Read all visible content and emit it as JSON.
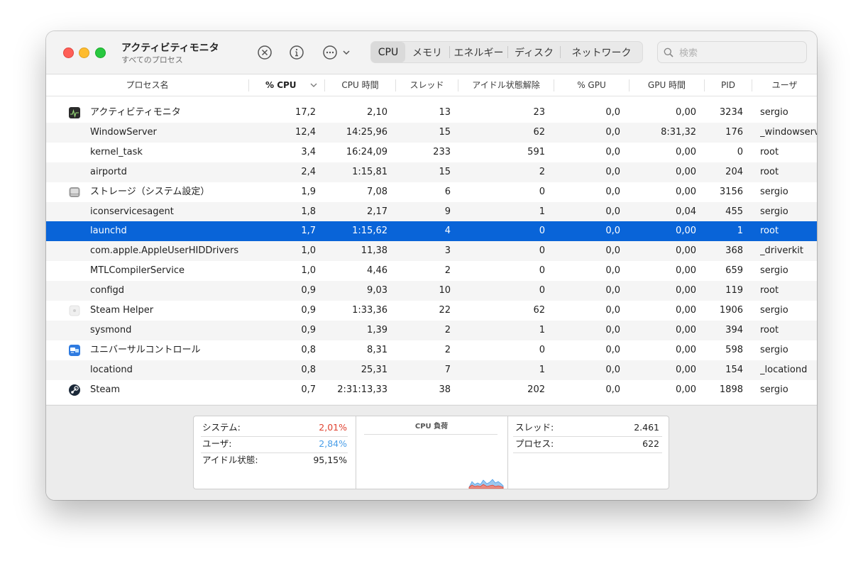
{
  "window": {
    "title": "アクティビティモニタ",
    "subtitle": "すべてのプロセス"
  },
  "toolbar": {
    "stop_icon": "x-circle-icon",
    "info_icon": "info-circle-icon",
    "more_icon": "ellipsis-circle-icon",
    "tabs": [
      "CPU",
      "メモリ",
      "エネルギー",
      "ディスク",
      "ネットワーク"
    ],
    "active_tab": "CPU",
    "search_placeholder": "検索"
  },
  "columns": [
    "プロセス名",
    "% CPU",
    "CPU 時間",
    "スレッド",
    "アイドル状態解除",
    "% GPU",
    "GPU 時間",
    "PID",
    "ユーザ"
  ],
  "processes": [
    {
      "name": "アクティビティモニタ",
      "icon": "activity-monitor-icon",
      "cpu": "17,2",
      "cpu_time": "2,10",
      "threads": "13",
      "wakeups": "23",
      "gpu": "0,0",
      "gpu_time": "0,00",
      "pid": "3234",
      "user": "sergio"
    },
    {
      "name": "WindowServer",
      "icon": "",
      "cpu": "12,4",
      "cpu_time": "14:25,96",
      "threads": "15",
      "wakeups": "62",
      "gpu": "0,0",
      "gpu_time": "8:31,32",
      "pid": "176",
      "user": "_windowserver"
    },
    {
      "name": "kernel_task",
      "icon": "",
      "cpu": "3,4",
      "cpu_time": "16:24,09",
      "threads": "233",
      "wakeups": "591",
      "gpu": "0,0",
      "gpu_time": "0,00",
      "pid": "0",
      "user": "root"
    },
    {
      "name": "airportd",
      "icon": "",
      "cpu": "2,4",
      "cpu_time": "1:15,81",
      "threads": "15",
      "wakeups": "2",
      "gpu": "0,0",
      "gpu_time": "0,00",
      "pid": "204",
      "user": "root"
    },
    {
      "name": "ストレージ（システム設定）",
      "icon": "storage-drive-icon",
      "cpu": "1,9",
      "cpu_time": "7,08",
      "threads": "6",
      "wakeups": "0",
      "gpu": "0,0",
      "gpu_time": "0,00",
      "pid": "3156",
      "user": "sergio"
    },
    {
      "name": "iconservicesagent",
      "icon": "",
      "cpu": "1,8",
      "cpu_time": "2,17",
      "threads": "9",
      "wakeups": "1",
      "gpu": "0,0",
      "gpu_time": "0,04",
      "pid": "455",
      "user": "sergio"
    },
    {
      "name": "launchd",
      "icon": "",
      "cpu": "1,7",
      "cpu_time": "1:15,62",
      "threads": "4",
      "wakeups": "0",
      "gpu": "0,0",
      "gpu_time": "0,00",
      "pid": "1",
      "user": "root",
      "selected": true
    },
    {
      "name": "com.apple.AppleUserHIDDrivers",
      "icon": "",
      "cpu": "1,0",
      "cpu_time": "11,38",
      "threads": "3",
      "wakeups": "0",
      "gpu": "0,0",
      "gpu_time": "0,00",
      "pid": "368",
      "user": "_driverkit"
    },
    {
      "name": "MTLCompilerService",
      "icon": "",
      "cpu": "1,0",
      "cpu_time": "4,46",
      "threads": "2",
      "wakeups": "0",
      "gpu": "0,0",
      "gpu_time": "0,00",
      "pid": "659",
      "user": "sergio"
    },
    {
      "name": "configd",
      "icon": "",
      "cpu": "0,9",
      "cpu_time": "9,03",
      "threads": "10",
      "wakeups": "0",
      "gpu": "0,0",
      "gpu_time": "0,00",
      "pid": "119",
      "user": "root"
    },
    {
      "name": "Steam Helper",
      "icon": "steam-helper-icon",
      "cpu": "0,9",
      "cpu_time": "1:33,36",
      "threads": "22",
      "wakeups": "62",
      "gpu": "0,0",
      "gpu_time": "0,00",
      "pid": "1906",
      "user": "sergio"
    },
    {
      "name": "sysmond",
      "icon": "",
      "cpu": "0,9",
      "cpu_time": "1,39",
      "threads": "2",
      "wakeups": "1",
      "gpu": "0,0",
      "gpu_time": "0,00",
      "pid": "394",
      "user": "root"
    },
    {
      "name": "ユニバーサルコントロール",
      "icon": "universal-control-icon",
      "cpu": "0,8",
      "cpu_time": "8,31",
      "threads": "2",
      "wakeups": "0",
      "gpu": "0,0",
      "gpu_time": "0,00",
      "pid": "598",
      "user": "sergio"
    },
    {
      "name": "locationd",
      "icon": "",
      "cpu": "0,8",
      "cpu_time": "25,31",
      "threads": "7",
      "wakeups": "1",
      "gpu": "0,0",
      "gpu_time": "0,00",
      "pid": "154",
      "user": "_locationd"
    },
    {
      "name": "Steam",
      "icon": "steam-icon",
      "cpu": "0,7",
      "cpu_time": "2:31:13,33",
      "threads": "38",
      "wakeups": "202",
      "gpu": "0,0",
      "gpu_time": "0,00",
      "pid": "1898",
      "user": "sergio"
    }
  ],
  "summary": {
    "system_label": "システム:",
    "system_value": "2,01%",
    "user_label": "ユーザ:",
    "user_value": "2,84%",
    "idle_label": "アイドル状態:",
    "idle_value": "95,15%",
    "graph_title": "CPU 負荷",
    "threads_label": "スレッド:",
    "threads_value": "2.461",
    "processes_label": "プロセス:",
    "processes_value": "622"
  },
  "colors": {
    "selection": "#0964d8",
    "system": "#e0412f",
    "user": "#4a9ee8"
  }
}
